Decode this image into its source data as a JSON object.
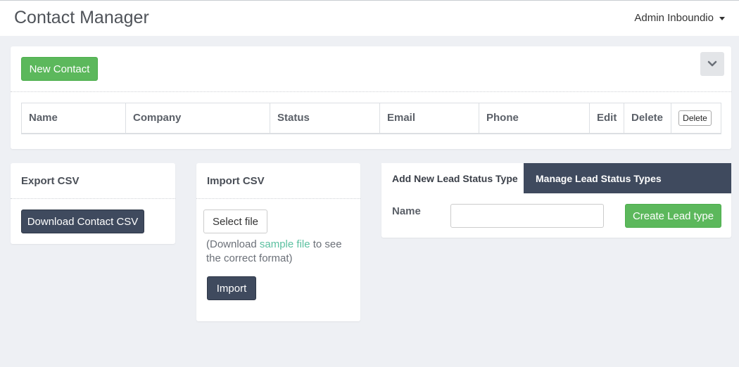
{
  "header": {
    "title": "Contact Manager",
    "user": "Admin Inboundio",
    "user_icon": "caret-down-icon"
  },
  "contacts_panel": {
    "new_button": "New Contact",
    "collapse_icon": "chevron-down-icon",
    "columns": [
      "Name",
      "Company",
      "Status",
      "Email",
      "Phone",
      "Edit",
      "Delete"
    ],
    "delete_button": "Delete"
  },
  "export": {
    "title": "Export CSV",
    "button": "Download Contact CSV"
  },
  "import": {
    "title": "Import CSV",
    "select_button": "Select file",
    "note_prefix": "(Download ",
    "note_link": "sample file",
    "note_suffix": " to see the correct format)",
    "button": "Import"
  },
  "lead": {
    "tab_add": "Add New Lead Status Type",
    "tab_manage": "Manage Lead Status Types",
    "name_label": "Name",
    "name_value": "",
    "create_button": "Create Lead type"
  },
  "colors": {
    "green": "#5cb85c",
    "dark": "#3f4a5e",
    "link": "#5bc0a0",
    "background": "#eef0f4"
  }
}
